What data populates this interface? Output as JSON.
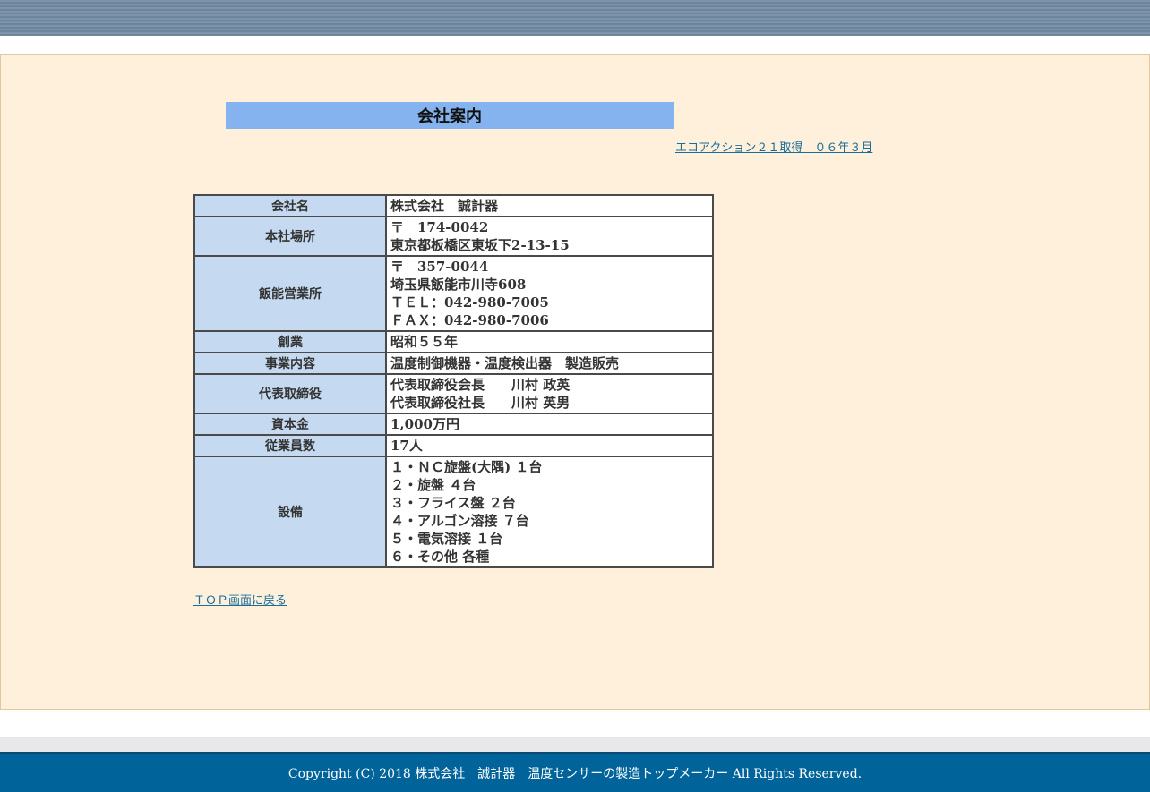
{
  "page": {
    "title": "会社案内",
    "eco_link": "エコアクション２１取得　０６年３月",
    "back_link": "ＴＯＰ画面に戻る",
    "footer": "Copyright (C) 2018 株式会社　誠計器　温度センサーの製造トップメーカー All Rights Reserved."
  },
  "colors": {
    "top_band": "#7d94ab",
    "panel_bg": "#fff0dc",
    "title_bg": "#84b3ef",
    "label_bg": "#c5daf0",
    "link": "#1a6d99",
    "footer_bg": "#00649a"
  },
  "company": {
    "rows": [
      {
        "label": "会社名",
        "lines": [
          "株式会社　誠計器"
        ]
      },
      {
        "label": "本社場所",
        "lines": [
          "〒　174-0042",
          "東京都板橋区東坂下2-13-15"
        ]
      },
      {
        "label": "飯能営業所",
        "lines": [
          "〒　357-0044",
          "埼玉県飯能市川寺608",
          "ＴＥＬ：042-980-7005",
          "ＦＡＸ：042-980-7006"
        ]
      },
      {
        "label": "創業",
        "lines": [
          "昭和５５年"
        ]
      },
      {
        "label": "事業内容",
        "lines": [
          "温度制御機器・温度検出器　製造販売"
        ]
      },
      {
        "label": "代表取締役",
        "lines": [
          "代表取締役会長　　川村 政英",
          "代表取締役社長　　川村 英男"
        ]
      },
      {
        "label": "資本金",
        "lines": [
          "1,000万円"
        ]
      },
      {
        "label": "従業員数",
        "lines": [
          "17人"
        ]
      },
      {
        "label": "設備",
        "lines": [
          "１・ＮＣ旋盤(大隅) １台",
          "２・旋盤 ４台",
          "３・フライス盤 ２台",
          "４・アルゴン溶接 ７台",
          "５・電気溶接 １台",
          "６・その他 各種"
        ]
      }
    ]
  }
}
